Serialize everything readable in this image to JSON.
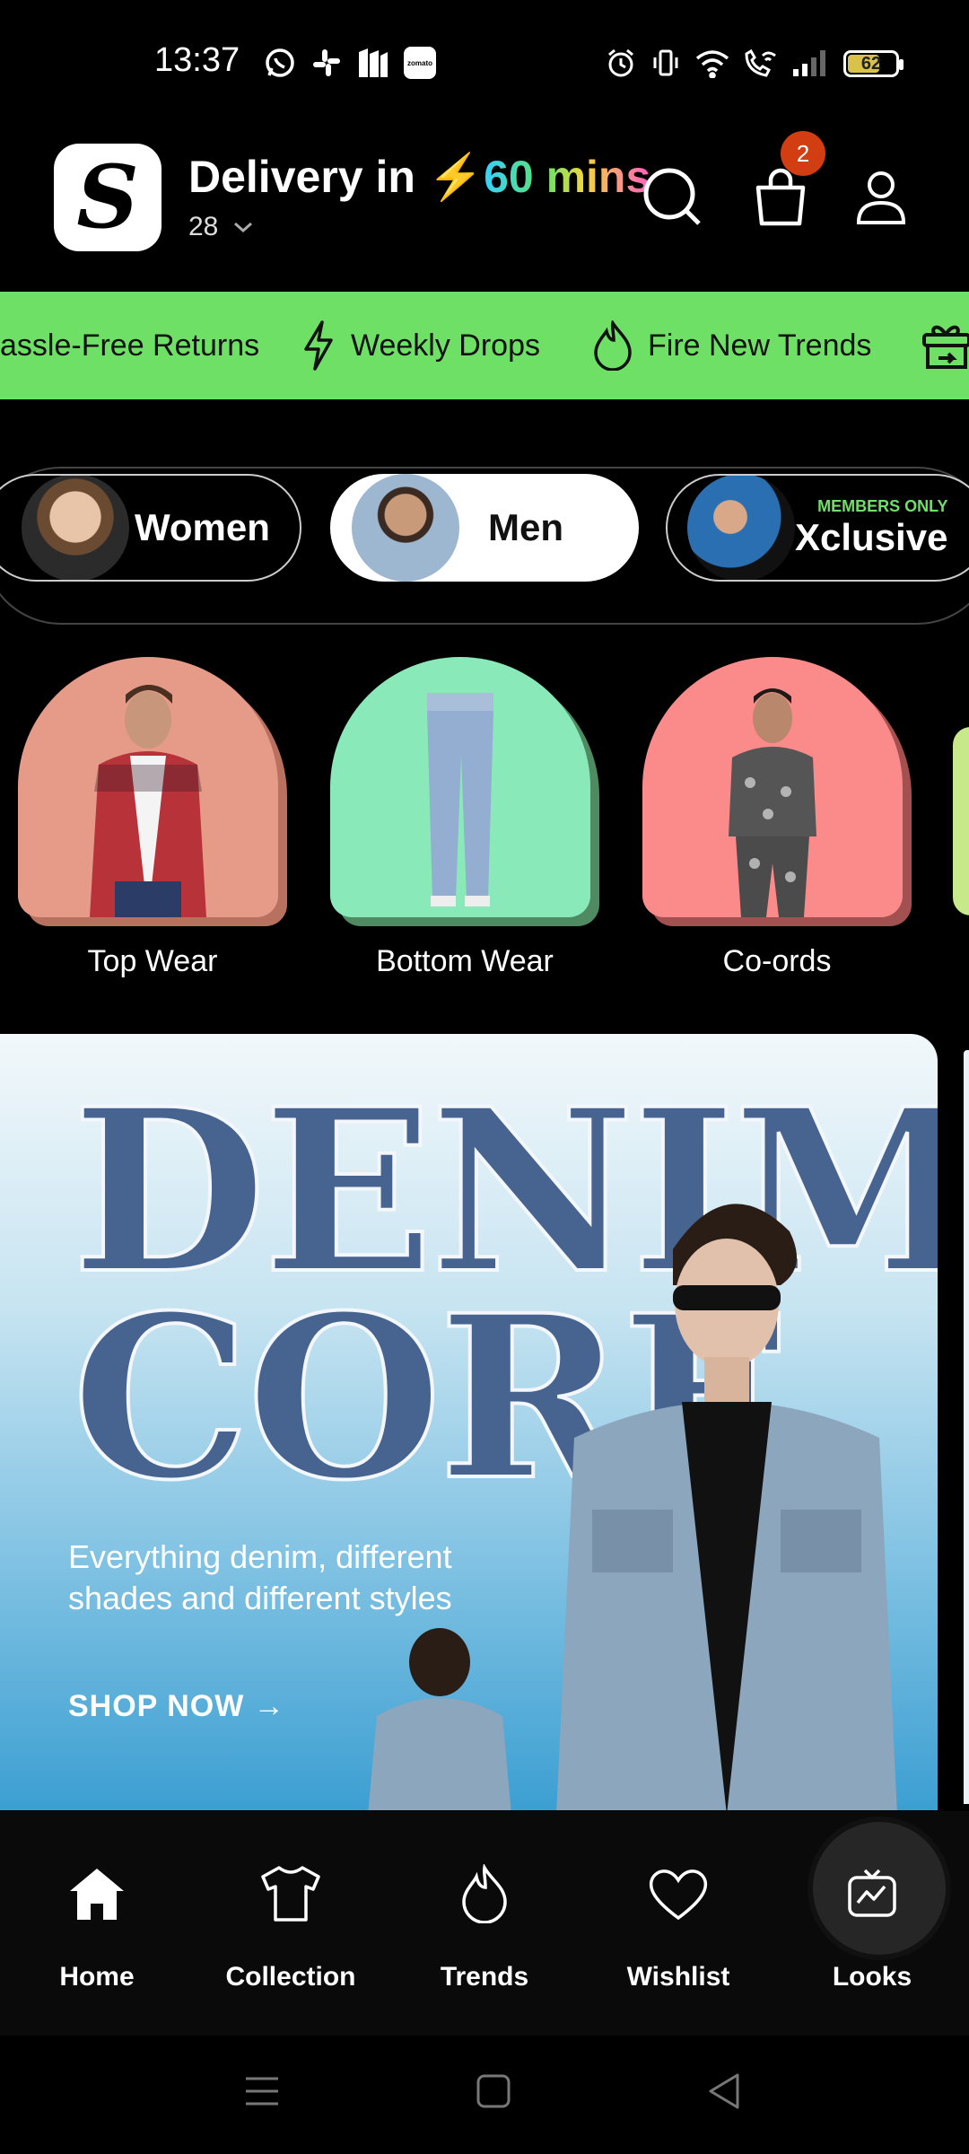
{
  "status_bar": {
    "time": "13:37",
    "left_icons": [
      "whatsapp-icon",
      "slack-icon",
      "app-m-icon",
      "zomato-icon"
    ],
    "zomato_label": "zomato",
    "right_icons": [
      "alarm-icon",
      "vibrate-icon",
      "wifi-icon",
      "wifi-call-icon",
      "signal-icon"
    ],
    "battery_level": "62"
  },
  "header": {
    "logo_letter": "S",
    "delivery_prefix": "Delivery in",
    "delivery_time": "60 mins",
    "address": "28",
    "cart_count": "2",
    "icons": [
      "search-icon",
      "cart-icon",
      "profile-icon"
    ]
  },
  "marquee": {
    "items": [
      {
        "icon": "return-icon",
        "label": "assle-Free Returns"
      },
      {
        "icon": "bolt-icon",
        "label": "Weekly Drops"
      },
      {
        "icon": "flame-icon",
        "label": "Fire New Trends"
      },
      {
        "icon": "gift-icon",
        "label": ""
      }
    ]
  },
  "gender_tabs": [
    {
      "label": "Women",
      "selected": false
    },
    {
      "label": "Men",
      "selected": true
    },
    {
      "label": "Xclusive",
      "tag": "MEMBERS ONLY",
      "selected": false
    }
  ],
  "categories": [
    {
      "label": "Top Wear",
      "color": "#e59b87",
      "shadow": "#b8705f"
    },
    {
      "label": "Bottom Wear",
      "color": "#8ae9b9",
      "shadow": "#4f8a62"
    },
    {
      "label": "Co-ords",
      "color": "#fb8a8a",
      "shadow": "#a25050"
    }
  ],
  "banner": {
    "headline_1": "DENIM",
    "headline_2": "CORE",
    "copy": "Everything denim, different shades and different styles",
    "cta": "SHOP NOW →"
  },
  "bottom_nav": [
    {
      "label": "Home",
      "icon": "home-icon",
      "active": true
    },
    {
      "label": "Collection",
      "icon": "tshirt-icon",
      "active": false
    },
    {
      "label": "Trends",
      "icon": "flame-icon",
      "active": false
    },
    {
      "label": "Wishlist",
      "icon": "heart-icon",
      "active": false
    },
    {
      "label": "Looks",
      "icon": "tv-trend-icon",
      "active": false
    }
  ],
  "colors": {
    "accent_green": "#6ee066",
    "badge_red": "#d23d12",
    "bolt_blue": "#3fd6ff"
  }
}
